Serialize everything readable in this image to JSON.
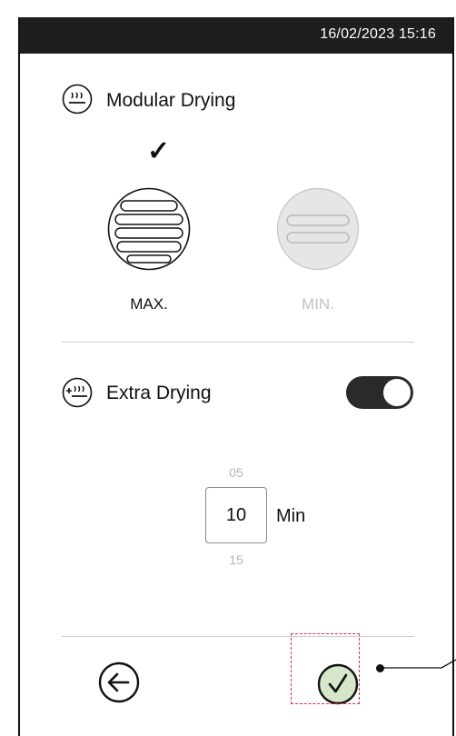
{
  "status_bar": {
    "datetime": "16/02/2023 15:16"
  },
  "modular_drying": {
    "title": "Modular Drying",
    "icon": "heat-waves-icon",
    "selected_check": "✓",
    "options": [
      {
        "label": "MAX.",
        "selected": true
      },
      {
        "label": "MIN.",
        "selected": false
      }
    ]
  },
  "extra_drying": {
    "title": "Extra Drying",
    "icon": "plus-heat-waves-icon",
    "toggle_on": true,
    "picker": {
      "previous": "05",
      "current": "10",
      "next": "15",
      "unit": "Min"
    }
  },
  "footer": {
    "back_icon": "back-arrow-icon",
    "confirm_icon": "confirm-check-icon"
  },
  "colors": {
    "status_bar": "#1e1e1e",
    "confirm_fill": "#d7e6c8",
    "highlight": "#e0303a",
    "disabled": "#e6e6e6"
  }
}
